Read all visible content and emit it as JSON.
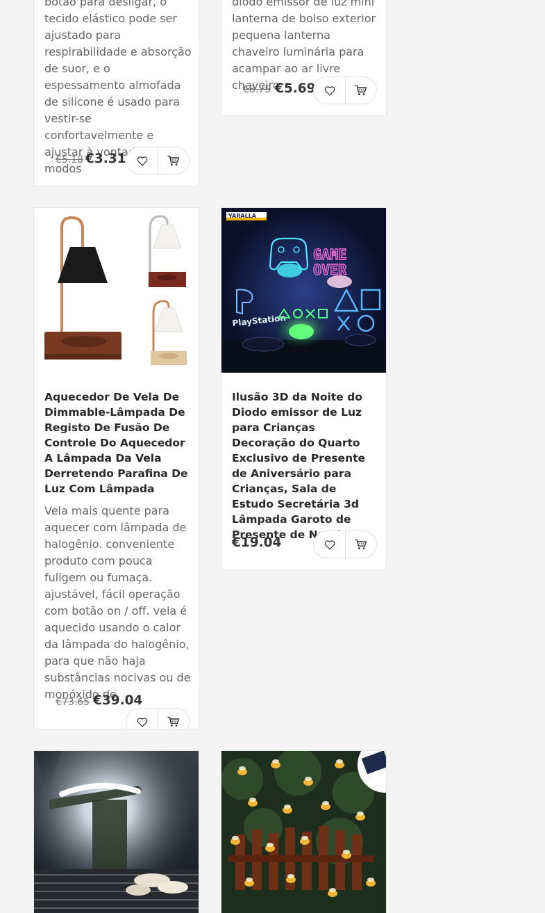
{
  "products": [
    {
      "description": "botão para desligar, o tecido elástico pode ser ajustado para respirabilidade e absorção de suor, e o espessamento almofada de silicone é usado para vestir-se confortavelmente e ajustar à vontade 2.3 modos",
      "old_price": "€5.18",
      "price": "€3.31"
    },
    {
      "description": "diodo emissor de luz mini lanterna de bolso exterior pequena lanterna chaveiro luminária para acampar ao ar livre chaveiro",
      "old_price": "€8.75",
      "price": "€5.69"
    },
    {
      "title": "Aquecedor De Vela De Dimmable-Lâmpada De Registo De Fusão De Controle Do Aquecedor A Lâmpada Da Vela Derretendo Parafina De Luz Com Lâmpada",
      "description": "Vela mais quente para aquecer com lâmpada de halogênio. conveniente produto com pouca fuligem ou fumaça. ajustável, fácil operação com botão on / off. vela é aquecido usando o calor da lâmpada do halogênio, para que não haja substâncias nocivas ou de monóxido de",
      "old_price": "€73.65",
      "price": "€39.04"
    },
    {
      "title": "Ilusão 3D da Noite do Diodo emissor de Luz para Crianças Decoração do Quarto Exclusivo de Presente de Aniversário para Crianças, Sala de Estudo Secretária 3d Lâmpada Garoto de Presente de Natal",
      "price": "€19.04",
      "image_text": {
        "brand": "YARALLA",
        "game": "GAME",
        "over": "OVER",
        "playstation": "PlayStation"
      }
    }
  ],
  "icons": {
    "wishlist": "heart-icon",
    "cart": "cart-icon"
  },
  "colors": {
    "background": "#f4f4f4",
    "card": "#ffffff",
    "border": "#e6e6e6",
    "text": "#333333"
  }
}
